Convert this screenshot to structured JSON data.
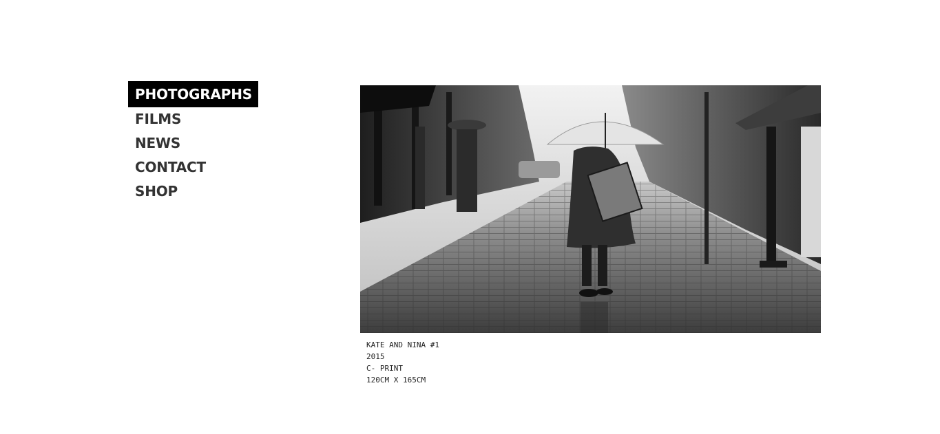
{
  "nav": {
    "items": [
      {
        "label": "PHOTOGRAPHS",
        "active": true
      },
      {
        "label": "FILMS",
        "active": false
      },
      {
        "label": "NEWS",
        "active": false
      },
      {
        "label": "CONTACT",
        "active": false
      },
      {
        "label": "SHOP",
        "active": false
      }
    ]
  },
  "photo": {
    "caption": {
      "title": "KATE AND NINA #1",
      "year": "2015",
      "medium": "C- PRINT",
      "dimensions": "120CM X 165CM"
    }
  },
  "colors": {
    "active_bg": "#000000",
    "active_text": "#ffffff",
    "nav_text": "#333333"
  }
}
